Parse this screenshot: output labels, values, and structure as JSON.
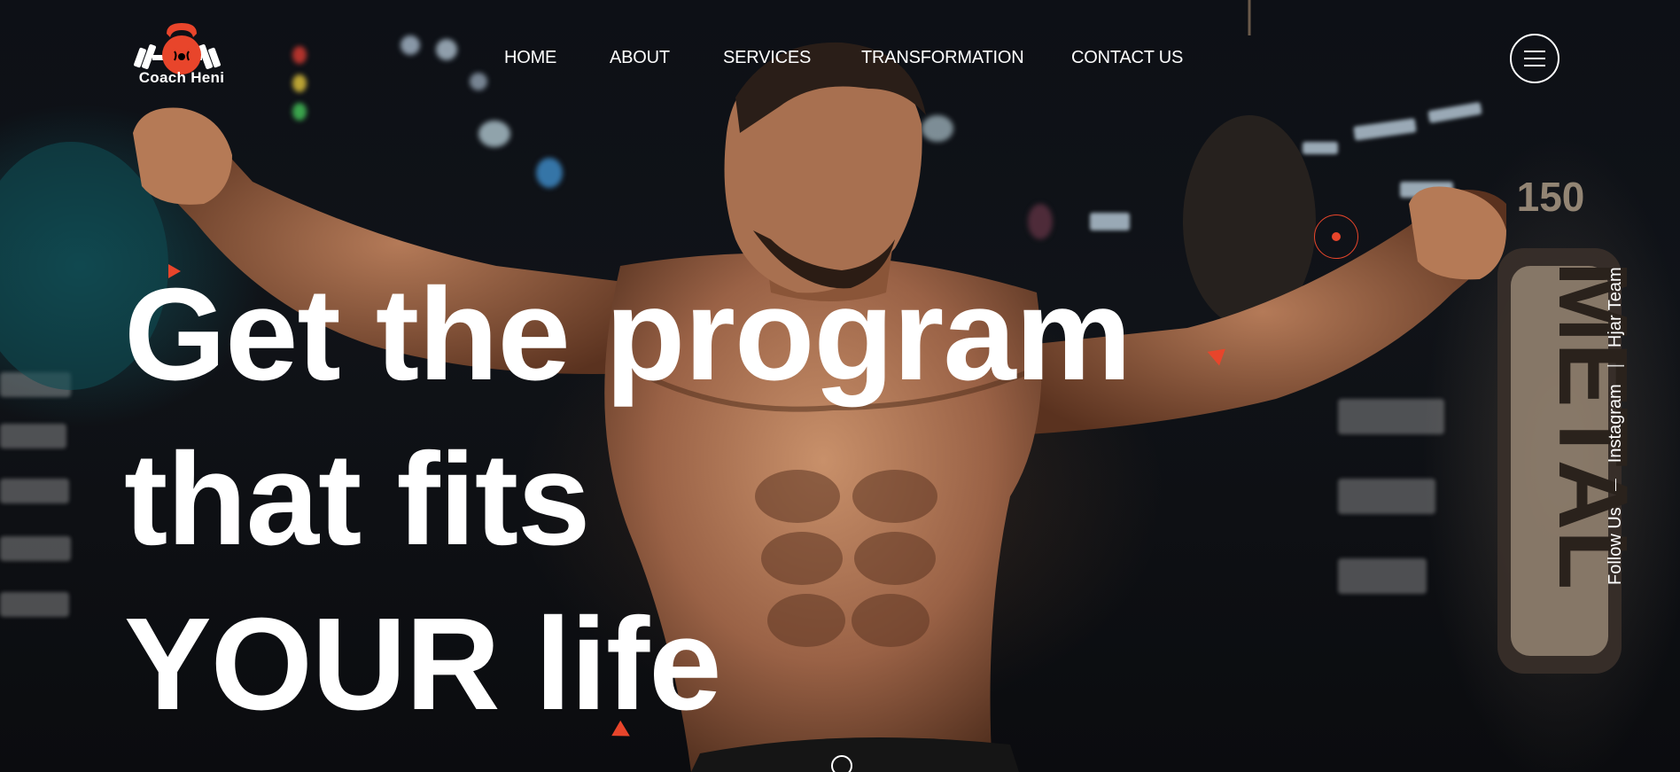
{
  "brand": {
    "name": "Coach Heni",
    "accent": "#e8452b",
    "logo_icon": "kettlebell-dumbbell-icon"
  },
  "nav": {
    "items": [
      {
        "label": "HOME"
      },
      {
        "label": "ABOUT"
      },
      {
        "label": "SERVICES"
      },
      {
        "label": "TRANSFORMATION"
      },
      {
        "label": "CONTACT US"
      }
    ],
    "menu_icon": "hamburger-menu-icon"
  },
  "hero": {
    "lines": [
      "Get the program",
      "that fits",
      "YOUR life"
    ]
  },
  "social": {
    "label": "Follow Us",
    "links": [
      {
        "label": "Instagram"
      },
      {
        "label": "Hjar Team"
      }
    ]
  }
}
